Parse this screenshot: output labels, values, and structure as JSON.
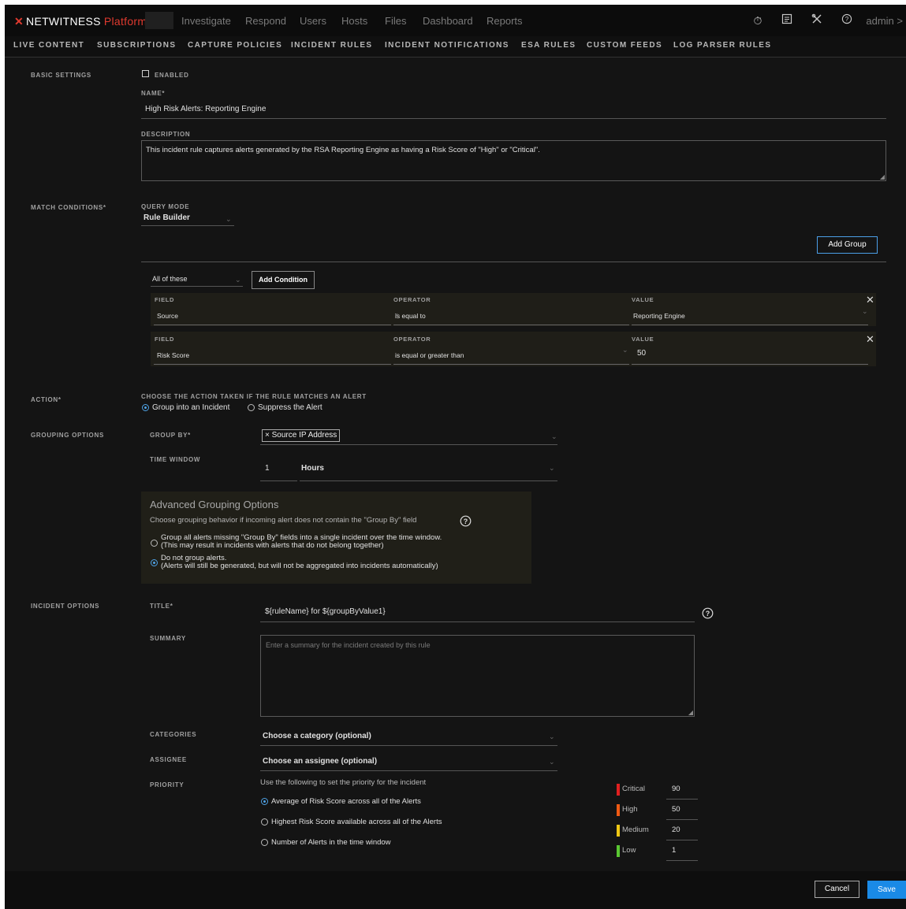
{
  "topnav": {
    "brand": "NETWITNESS",
    "brand_suffix": "Platform",
    "items": [
      "Investigate",
      "Respond",
      "Users",
      "Hosts",
      "Files",
      "Dashboard",
      "Reports"
    ],
    "admin": "admin >"
  },
  "subnav": [
    "LIVE CONTENT",
    "SUBSCRIPTIONS",
    "CAPTURE POLICIES",
    "INCIDENT RULES",
    "INCIDENT NOTIFICATIONS",
    "ESA RULES",
    "CUSTOM FEEDS",
    "LOG PARSER RULES"
  ],
  "basic": {
    "section": "BASIC SETTINGS",
    "enabled_label": "ENABLED",
    "enabled": false,
    "name_label": "NAME*",
    "name_value": "High Risk Alerts: Reporting Engine",
    "desc_label": "DESCRIPTION",
    "desc_value": "This incident rule captures alerts generated by the RSA Reporting Engine as having a Risk Score of \"High\" or \"Critical\"."
  },
  "match": {
    "section": "MATCH CONDITIONS*",
    "query_mode_label": "QUERY MODE",
    "query_mode_value": "Rule Builder",
    "add_group": "Add Group",
    "all_of": "All of these",
    "add_condition": "Add Condition",
    "field_label": "FIELD",
    "operator_label": "OPERATOR",
    "value_label": "VALUE",
    "conditions": [
      {
        "field": "Source",
        "operator": "is equal to",
        "value": "Reporting Engine"
      },
      {
        "field": "Risk Score",
        "operator": "is equal or greater than",
        "value": "50"
      }
    ]
  },
  "action": {
    "section": "ACTION*",
    "prompt": "CHOOSE THE ACTION TAKEN IF THE RULE MATCHES AN ALERT",
    "opt1": "Group into an Incident",
    "opt2": "Suppress the Alert",
    "selected": "Group into an Incident"
  },
  "grouping": {
    "section": "GROUPING OPTIONS",
    "group_by_label": "GROUP BY*",
    "group_by_tag": "× Source IP Address",
    "time_window_label": "TIME WINDOW",
    "time_window_value": "1",
    "time_window_unit": "Hours",
    "adv_title": "Advanced Grouping Options",
    "adv_desc": "Choose grouping behavior if incoming alert does not contain the \"Group By\" field",
    "adv_opt1_line1": "Group all alerts missing \"Group By\" fields into a single incident over the time window.",
    "adv_opt1_line2": "(This may result in incidents with alerts that do not belong together)",
    "adv_opt2_line1": "Do not group alerts.",
    "adv_opt2_line2": "(Alerts will still be generated, but will not be aggregated into incidents automatically)",
    "adv_selected": "Do not group alerts."
  },
  "incident": {
    "section": "INCIDENT OPTIONS",
    "title_label": "TITLE*",
    "title_value": "${ruleName} for ${groupByValue1}",
    "summary_label": "SUMMARY",
    "summary_placeholder": "Enter a summary for the incident created by this rule",
    "categories_label": "CATEGORIES",
    "categories_value": "Choose a category (optional)",
    "assignee_label": "ASSIGNEE",
    "assignee_value": "Choose an assignee (optional)",
    "priority_label": "PRIORITY",
    "priority_prompt": "Use the following to set the priority for the incident",
    "priority_opts": [
      "Average of Risk Score across all of the Alerts",
      "Highest Risk Score available across all of the Alerts",
      "Number of Alerts in the time window"
    ],
    "priority_selected": "Average of Risk Score across all of the Alerts",
    "levels": [
      {
        "name": "Critical",
        "value": "90",
        "color": "#e02020"
      },
      {
        "name": "High",
        "value": "50",
        "color": "#f05a14"
      },
      {
        "name": "Medium",
        "value": "20",
        "color": "#f0c814"
      },
      {
        "name": "Low",
        "value": "1",
        "color": "#5ac832"
      }
    ]
  },
  "footer": {
    "cancel": "Cancel",
    "save": "Save"
  }
}
